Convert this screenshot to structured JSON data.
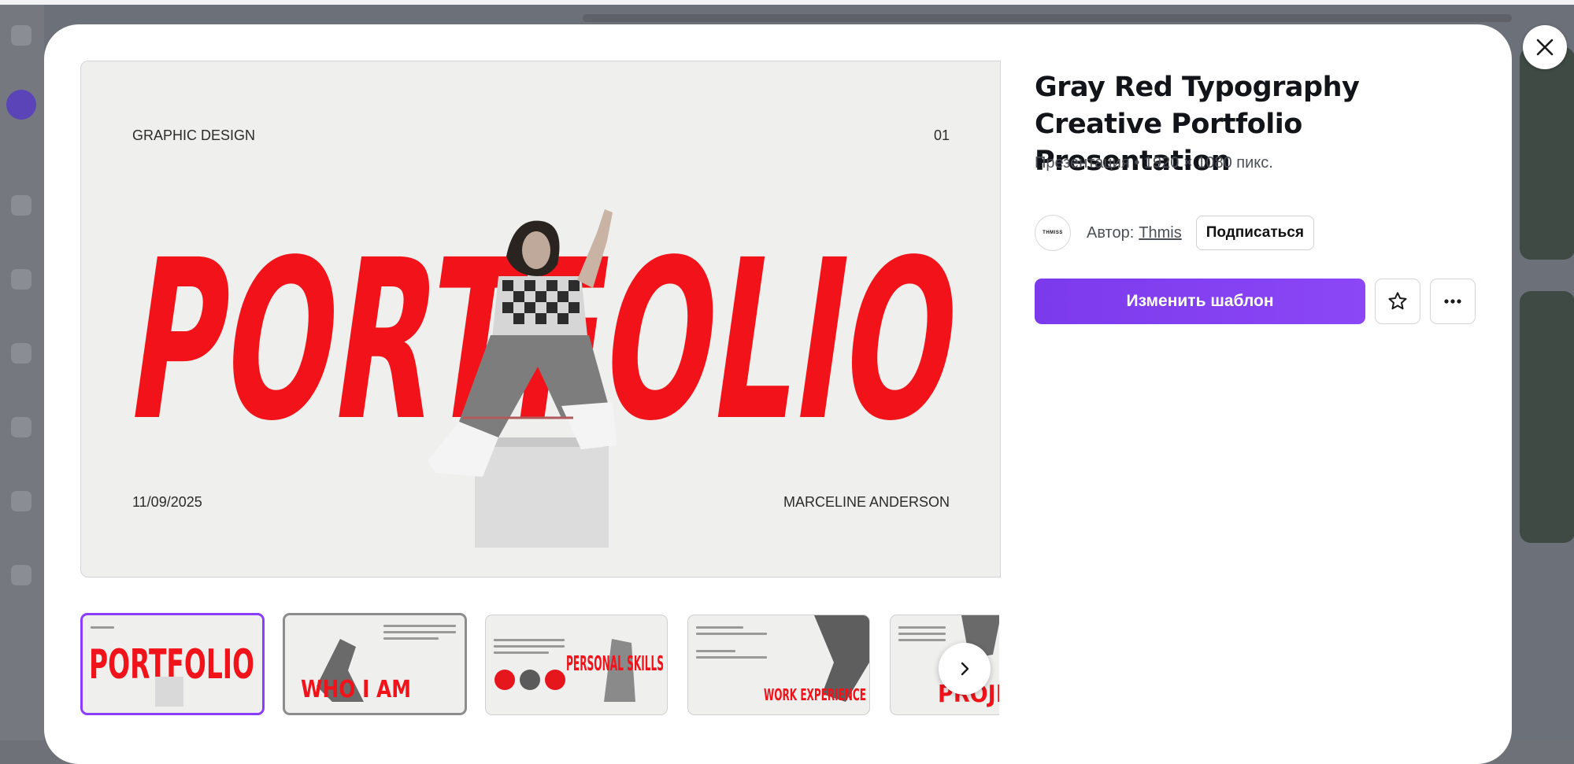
{
  "template": {
    "title": "Gray Red Typography Creative Portfolio Presentation",
    "meta": "Презентация • 1920 × 1080 пикс.",
    "author_prefix": "Автор:",
    "author_name": "Thmis",
    "author_logo_text": "THMISS",
    "subscribe_label": "Подписаться",
    "edit_label": "Изменить шаблон"
  },
  "preview_slide": {
    "top_left": "GRAPHIC DESIGN",
    "top_right": "01",
    "headline": "PORTFOLIO",
    "bottom_left": "11/09/2025",
    "bottom_right": "MARCELINE ANDERSON"
  },
  "thumbnails": [
    {
      "headline": "PORTFOLIO",
      "selected": true
    },
    {
      "headline": "WHO I AM",
      "selected": false
    },
    {
      "headline": "PERSONAL SKILLS",
      "selected": false
    },
    {
      "headline": "WORK EXPERIENCE",
      "selected": false
    },
    {
      "headline": "PROJECTS",
      "selected": false
    }
  ],
  "colors": {
    "accent_purple": "#8b3dff",
    "slide_red": "#f2131a",
    "slide_bg": "#efefed"
  },
  "icons": {
    "close": "close-icon",
    "star": "star-icon",
    "more": "more-horizontal-icon",
    "next": "chevron-right-icon"
  }
}
